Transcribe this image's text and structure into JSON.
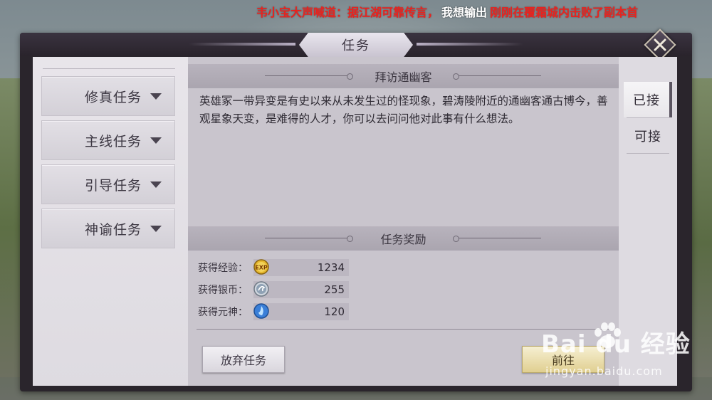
{
  "marquee": {
    "red_part1": "韦小宝大声喊道：据江湖可靠传言，",
    "white_part": "我想输出",
    "red_part2": "刚刚在覆霜城内击败了副本首"
  },
  "window": {
    "title": "任务"
  },
  "left_menu": {
    "items": [
      {
        "label": "修真任务"
      },
      {
        "label": "主线任务"
      },
      {
        "label": "引导任务"
      },
      {
        "label": "神谕任务"
      }
    ]
  },
  "quest": {
    "name": "拜访通幽客",
    "description": "英雄冢一带异变是有史以来从未发生过的怪现象，碧涛陵附近的通幽客通古博今，善观星象天变，是难得的人才，你可以去问问他对此事有什么想法。"
  },
  "rewards": {
    "header": "任务奖励",
    "items": [
      {
        "label": "获得经验：",
        "value": "1234",
        "icon": "exp-icon"
      },
      {
        "label": "获得银币：",
        "value": "255",
        "icon": "silver-coin-icon"
      },
      {
        "label": "获得元神：",
        "value": "120",
        "icon": "spirit-icon"
      }
    ]
  },
  "buttons": {
    "abandon": "放弃任务",
    "go": "前往"
  },
  "tabs": [
    {
      "label": "已接",
      "active": true
    },
    {
      "label": "可接",
      "active": false
    }
  ],
  "watermark": {
    "logo": "Bai  du 经验",
    "url": "jingyan.baidu.com"
  },
  "colors": {
    "marquee_red": "#e8231f",
    "panel_light": "#dedbe1",
    "content_bg": "#c9c5cd",
    "go_button": "#e0cf90"
  }
}
